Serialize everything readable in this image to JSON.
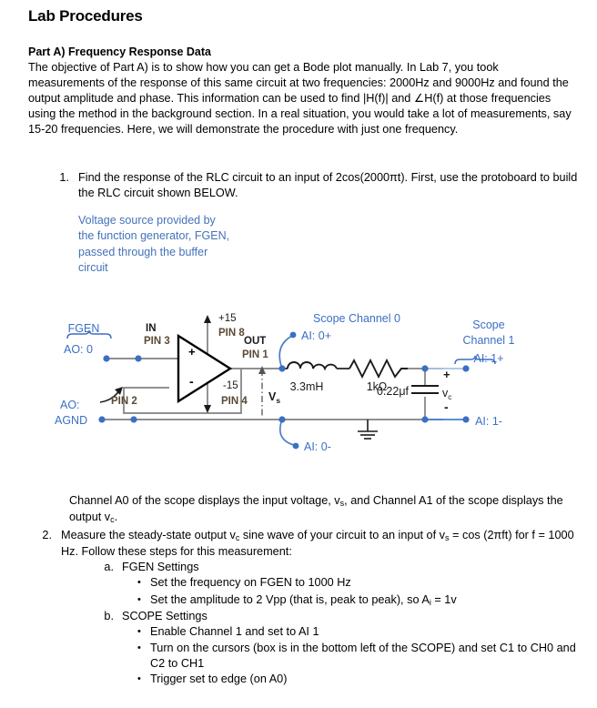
{
  "document": {
    "title": "Lab Procedures",
    "section_heading": "Part A) Frequency Response Data",
    "intro_paragraph": "The objective of Part A) is to show how you can get a Bode plot manually. In Lab 7, you took measurements of the response of this same circuit at two frequencies: 2000Hz and 9000Hz and found the output amplitude and phase. This information can be used to find |H(f)| and ∠H(f) at those frequencies using the method in the background section. In a real situation, you would take a lot of measurements, say 15-20 frequencies. Here, we will demonstrate the procedure with just one frequency."
  },
  "step1": {
    "number": "1.",
    "text": "Find the response of the RLC circuit to an input of 2cos(2000πt). First, use the protoboard to build the RLC circuit shown BELOW."
  },
  "annotation": {
    "line1": "Voltage source provided by",
    "line2": "the function generator, FGEN,",
    "line3": "passed through the buffer",
    "line4": "circuit",
    "color": "#4472b8"
  },
  "circuit": {
    "fgen_label": "FGEN",
    "ao0_label": "AO: 0",
    "ao_label": "AO:",
    "agnd_label": "AGND",
    "in_label": "IN",
    "pin3_label": "PIN 3",
    "pin2_label": "PIN 2",
    "pin8_label": "PIN 8",
    "pin4_label": "PIN 4",
    "pin1_label": "PIN 1",
    "out_label": "OUT",
    "plus15_label": "+15",
    "minus15_label": "-15",
    "opamp_plus": "+",
    "opamp_minus": "-",
    "vs_label": "V",
    "vs_sub": "s",
    "vc_label": "v",
    "vc_sub": "c",
    "inductor_value": "3.3mH",
    "resistor_value": "1kΩ",
    "capacitor_value": "0.22μf",
    "cap_plus": "+",
    "cap_minus": "-",
    "scope_ch0_line1": "Scope Channel 0",
    "ai0p_label": "AI: 0+",
    "ai0m_label": "AI: 0-",
    "scope_ch1_line1": "Scope",
    "scope_ch1_line2": "Channel 1",
    "ai1p_label": "AI: 1+",
    "ai1m_label": "AI: 1-",
    "wire_color": "#808080",
    "blue_color": "#3a6fc4",
    "pin_color": "#5a4a34",
    "component_color": "#1a1a1a"
  },
  "notes": {
    "channel_note": "Channel A0 of the scope displays the input voltage, v",
    "channel_note_sub1": "s",
    "channel_note_mid": ", and Channel A1 of the scope displays the output v",
    "channel_note_sub2": "c",
    "channel_note_end": "."
  },
  "step2": {
    "number": "2.",
    "text_a": "Measure the steady-state output v",
    "sub_a": "c",
    "text_b": " sine wave of your circuit to an input of v",
    "sub_b": "s",
    "text_c": " = cos (2πft) for f = 1000 Hz. Follow these steps for this measurement:",
    "sub_items": [
      {
        "marker": "a.",
        "label": "FGEN Settings",
        "bullets": [
          {
            "text_a": "Set the frequency on FGEN to 1000 Hz",
            "sub": "",
            "text_b": ""
          },
          {
            "text_a": "Set the amplitude to 2 Vpp (that is, peak to peak), so A",
            "sub": "i",
            "text_b": " = 1v"
          }
        ]
      },
      {
        "marker": "b.",
        "label": "SCOPE Settings",
        "bullets": [
          {
            "text_a": "Enable Channel 1 and set to AI 1",
            "sub": "",
            "text_b": ""
          },
          {
            "text_a": "Turn on the cursors (box is in the bottom left of the SCOPE) and set C1 to CH0 and C2 to CH1",
            "sub": "",
            "text_b": ""
          },
          {
            "text_a": "Trigger set to edge (on A0)",
            "sub": "",
            "text_b": ""
          }
        ]
      }
    ]
  }
}
